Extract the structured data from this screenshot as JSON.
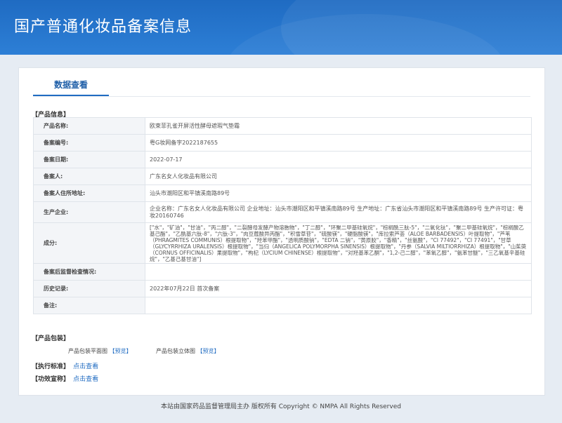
{
  "header": {
    "title": "国产普通化妆品备案信息"
  },
  "tabs": {
    "active": "数据查看"
  },
  "sections": {
    "product_info": "【产品信息】",
    "packaging": "【产品包装】",
    "standard": "【执行标准】",
    "claims": "【功效宣称】"
  },
  "rows": [
    {
      "label": "产品名称:",
      "value": "欧束菲孔雀开屏活性酵母遮瑕气垫霜"
    },
    {
      "label": "备案编号:",
      "value": "粤G妆网备字2022187655"
    },
    {
      "label": "备案日期:",
      "value": "2022-07-17"
    },
    {
      "label": "备案人:",
      "value": "广东名女人化妆品有限公司"
    },
    {
      "label": "备案人住所地址:",
      "value": "汕头市潮阳区和平镇溪南路89号"
    },
    {
      "label": "生产企业:",
      "value": "企业名称：广东名女人化妆品有限公司 企业地址：汕头市潮阳区和平镇溪南路89号 生产地址：广东省汕头市潮阳区和平镇溪南路89号 生产许可证：粤妆20160746"
    },
    {
      "label": "成分:",
      "value": "[\"水\"，\"矿油\"，\"甘油\"，\"丙二醇\"，\"二裂酵母发酵产物溶胞物\"，\"丁二醇\"，\"环聚二甲基硅氧烷\"，\"棕榈酰三肽-5\"，\"二氧化钛\"，\"聚二甲基硅氧烷\"，\"棕榈酸乙基己酯\"，\"乙酰基六肽-8\"，\"六肽-3\"，\"肉豆蔻酸异丙酯\"，\"积雪草苷\"，\"硫酸镁\"，\"硬脂酸镁\"，\"库拉索芦荟（ALOE BARBADENSIS）叶提取物\"，\"芦苇（PHRAGMITES COMMUNIS）根提取物\"，\"羟苯甲酯\"，\"透明质酸钠\"，\"EDTA 二钠\"，\"黄原胶\"，\"香精\"，\"丝氨酸\"，\"CI 77492\"，\"CI 77491\"，\"甘草（GLYCYRRHIZA URALENSIS）根提取物\"，\"当归（ANGELICA POLYMORPHA SINENSIS）根提取物\"，\"丹参（SALVIA MILTIORRHIZA）根提取物\"，\"山茱萸（CORNUS OFFICINALIS）果提取物\"，\"枸杞（LYCIUM CHINENSE）根提取物\"，\"对羟基苯乙酮\"，\"1,2-己二醇\"，\"苯氧乙醇\"，\"氨苯甘醚\"，\"三乙氧基辛基硅烷\"，\"乙基己基甘油\"]"
    },
    {
      "label": "备案后监督检查情况:",
      "value": ""
    },
    {
      "label": "历史记录:",
      "value": "2022年07月22日 首次备案"
    },
    {
      "label": "备注:",
      "value": ""
    }
  ],
  "packaging": {
    "flat_label": "产品包装平面图",
    "flat_link": "【预览】",
    "solid_label": "产品包装立体图",
    "solid_link": "【预览】"
  },
  "standard_link": "点击查看",
  "claims_link": "点击查看",
  "footer": "本站由国家药品监督管理局主办 版权所有 Copyright © NMPA All Rights Reserved"
}
